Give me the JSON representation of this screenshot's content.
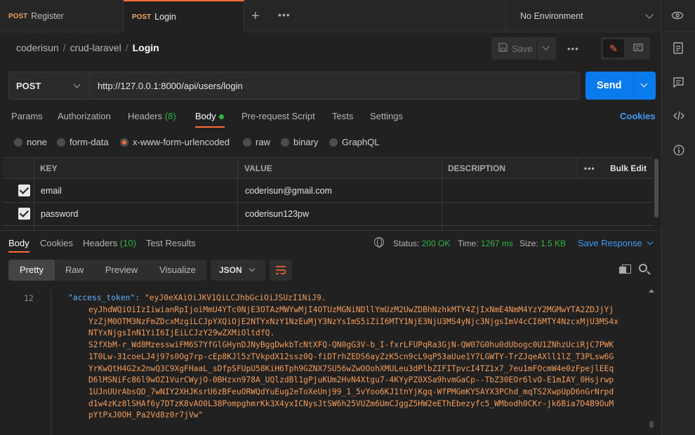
{
  "tabs": [
    {
      "method": "POST",
      "label": "Register"
    },
    {
      "method": "POST",
      "label": "Login"
    }
  ],
  "environment": {
    "label": "No Environment"
  },
  "breadcrumb": {
    "workspace": "coderisun",
    "collection": "crud-laravel",
    "request": "Login"
  },
  "toolbar": {
    "save_label": "Save"
  },
  "request": {
    "method": "POST",
    "url": "http://127.0.0.1:8000/api/users/login",
    "send_label": "Send"
  },
  "request_tabs": [
    {
      "label": "Params"
    },
    {
      "label": "Authorization"
    },
    {
      "label": "Headers",
      "count": "(8)"
    },
    {
      "label": "Body"
    },
    {
      "label": "Pre-request Script"
    },
    {
      "label": "Tests"
    },
    {
      "label": "Settings"
    }
  ],
  "cookies_label": "Cookies",
  "body_types": [
    {
      "label": "none",
      "selected": false
    },
    {
      "label": "form-data",
      "selected": false
    },
    {
      "label": "x-www-form-urlencoded",
      "selected": true
    },
    {
      "label": "raw",
      "selected": false
    },
    {
      "label": "binary",
      "selected": false
    },
    {
      "label": "GraphQL",
      "selected": false
    }
  ],
  "table": {
    "headers": {
      "key": "KEY",
      "value": "VALUE",
      "description": "DESCRIPTION",
      "bulk_edit": "Bulk Edit"
    },
    "rows": [
      {
        "key": "email",
        "value": "coderisun@gmail.com",
        "checked": true
      },
      {
        "key": "password",
        "value": "coderisun123pw",
        "checked": true
      }
    ]
  },
  "response_tabs": [
    {
      "label": "Body"
    },
    {
      "label": "Cookies"
    },
    {
      "label": "Headers",
      "count": "(10)"
    },
    {
      "label": "Test Results"
    }
  ],
  "response_meta": {
    "status_label": "Status:",
    "status_value": "200 OK",
    "time_label": "Time:",
    "time_value": "1267 ms",
    "size_label": "Size:",
    "size_value": "1.5 KB",
    "save_response": "Save Response"
  },
  "view_modes": [
    "Pretty",
    "Raw",
    "Preview",
    "Visualize"
  ],
  "format": "JSON",
  "code": {
    "line_number": "12",
    "key": "\"access_token\": ",
    "first_line": "\"eyJ0eXAiOiJKV1QiLCJhbGciOiJSUzI1NiJ9.",
    "lines": [
      "eyJhdWQiOiIzIiwianRpIjoiMmU4YTc0NjE3OTAzMWYwMjI4OTUzMGNiNDllYmUzM2UwZDBhNzhkMTY4ZjIxNmE4NmM4YzY2MGMwYTA2ZDJjYj",
      "YzZjM0OTM3NzFmZDcxMzgiLCJpYXQiOjE2NTYxNzY1NzEuMjY3NzYsImS5iZiI6MTY1NjE3NjU3MS4yNjc3NjgsImV4cCI6MTY4NzcxMjU3MS4x",
      "NTYxNjgsInN1YiI6IjEiLCJzY29wZXMiOltdfQ.",
      "S2fXbM-r_Wd8MzesswiFM6S7YfGlGHynDJNyBggDwkbTcNtXFQ-QN0gG3V-b_I-fxrLFUPqRa3GjN-QW07G0hu0dUbogc0U1ZNhzUciRjC7PWK",
      "1T0Lw-31coeLJ4j97s0Og7rp-cEp8KJl5zTVkpdX12ssz0Q-fiDTrhZEDS6ayZzK5cn9cL9qP53aUue1Y7LGWTY-TrZJqeAXll1lZ_T3PLsw6G",
      "YrKwQtH4G2x2nwQ3C9XgFHaaL_sDfpSFUpU58KiH6Tph9GZNX7SU56wZwOOohXMULeu3dPlbZIFITpvcI4TZ1x7_7eu1mFOcmW4e0zFpejlEEq",
      "D6lMSNiFc86l9wOZ1VurCWyjO-0BHzxn978A_UQlzdBl1gPjuKUm2HvN4Xtgu7-4KYyPZ0XSa9hvmGaCp--TbZ30EOr6lvO-E1mIAY_0Hsjrwp",
      "1UJnUUrAbsQD_7wNIY2XHJKsrU6zBFeuORWQdYuEug2eToXeUnj99_1_5vYoo6KJ1tnYjKgq-WfPMGmKYSAYX3PChd_mqTS2XwpUpD6nGrNrpd",
      "d1w4zKz8lSHAf6y7DTzK8vAO0L38PompghmrKk3X4yxICNysJtSW6h25VUZm6UmCJggZ5HW2eEThEbezyfc5_WMbodh0CKr-jk6Bia7D4B9OuM",
      "pYtPxJ0OH_Pa2Vd8z0r7jVw\""
    ]
  }
}
